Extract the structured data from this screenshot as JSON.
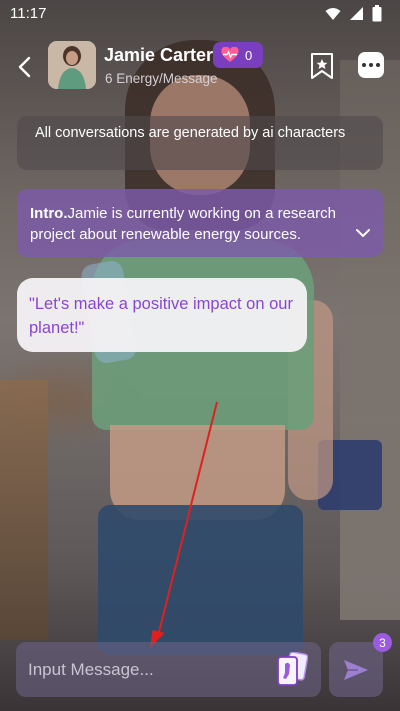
{
  "status": {
    "time": "11:17"
  },
  "header": {
    "name": "Jamie Carter",
    "subtitle": "6 Energy/Message",
    "energy_count": "0"
  },
  "notice": "All conversations are generated by ai characters",
  "intro": {
    "label": "Intro.",
    "text": "Jamie is currently working on a research project about renewable energy sources."
  },
  "message": "\"Let's make a positive impact on our planet!\"",
  "input": {
    "placeholder": "Input Message..."
  },
  "send": {
    "badge": "3"
  },
  "colors": {
    "accent": "#9a5be0",
    "bubble_text": "#8a46d2",
    "annotation_arrow": "#e0201e"
  },
  "icons": [
    "back-arrow-icon",
    "heart-pulse-icon",
    "bookmark-star-icon",
    "more-dots-icon",
    "chevron-down-icon",
    "card-stack-icon",
    "send-icon"
  ]
}
